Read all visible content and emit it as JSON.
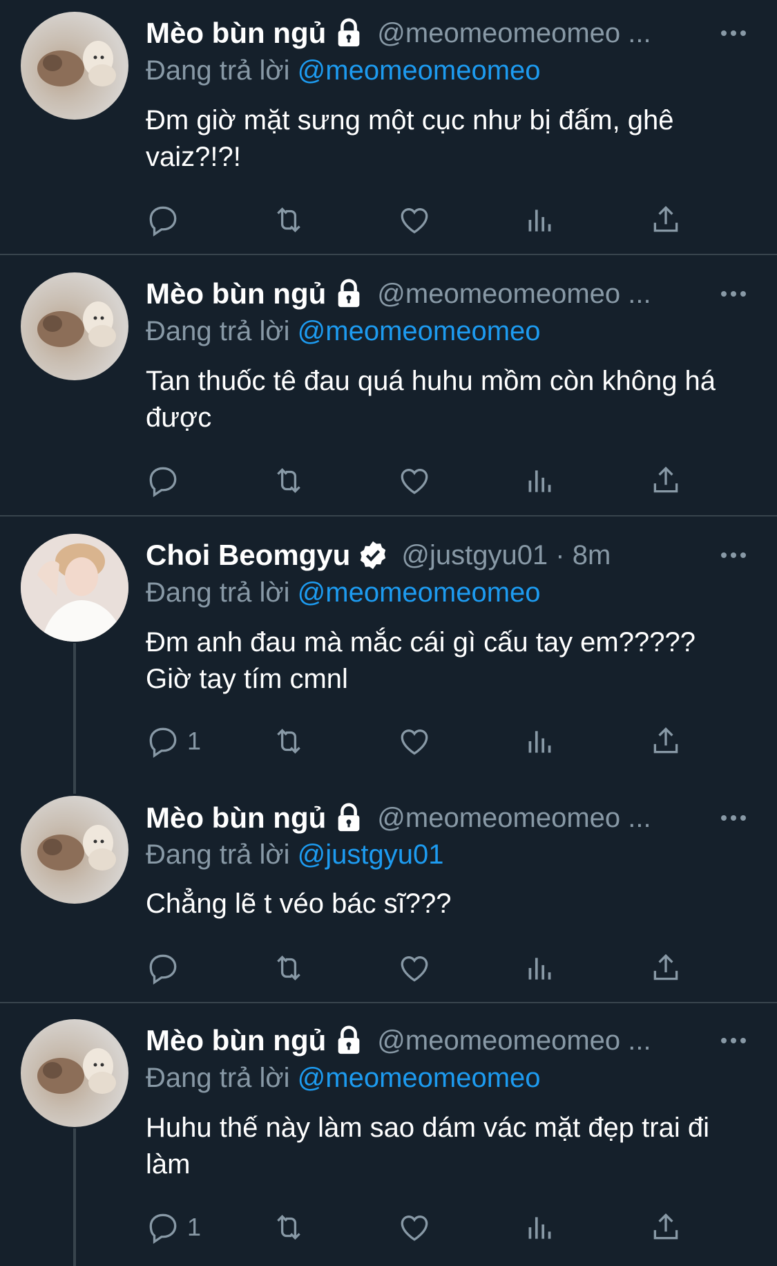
{
  "reply_prefix": "Đang trả lời",
  "tweets": [
    {
      "display_name": "Mèo bùn ngủ",
      "handle": "@meomeomeomeo ...",
      "reply_to": "@meomeomeomeo",
      "text": "Đm giờ mặt sưng một cục như bị đấm, ghê vaiz?!?!",
      "reply_count": ""
    },
    {
      "display_name": "Mèo bùn ngủ",
      "handle": "@meomeomeomeo ...",
      "reply_to": "@meomeomeomeo",
      "text": "Tan thuốc tê đau quá huhu mồm còn không há được",
      "reply_count": ""
    },
    {
      "display_name": "Choi Beomgyu",
      "handle": "@justgyu01 · 8m",
      "reply_to": "@meomeomeomeo",
      "text": "Đm anh đau mà mắc cái gì cấu tay em????? Giờ tay tím cmnl",
      "reply_count": "1"
    },
    {
      "display_name": "Mèo bùn ngủ",
      "handle": "@meomeomeomeo ...",
      "reply_to": "@justgyu01",
      "text": "Chẳng lẽ t véo bác sĩ???",
      "reply_count": ""
    },
    {
      "display_name": "Mèo bùn ngủ",
      "handle": "@meomeomeomeo ...",
      "reply_to": "@meomeomeomeo",
      "text": "Huhu thế này làm sao dám vác mặt đẹp trai đi làm",
      "reply_count": "1"
    }
  ],
  "colors": {
    "background": "#15202b",
    "secondary_text": "#8899a6",
    "link": "#1d9bf0",
    "divider": "#38444d"
  },
  "icons": [
    "lock-icon",
    "verified-icon",
    "more-icon",
    "reply-icon",
    "retweet-icon",
    "like-icon",
    "views-icon",
    "share-icon"
  ]
}
